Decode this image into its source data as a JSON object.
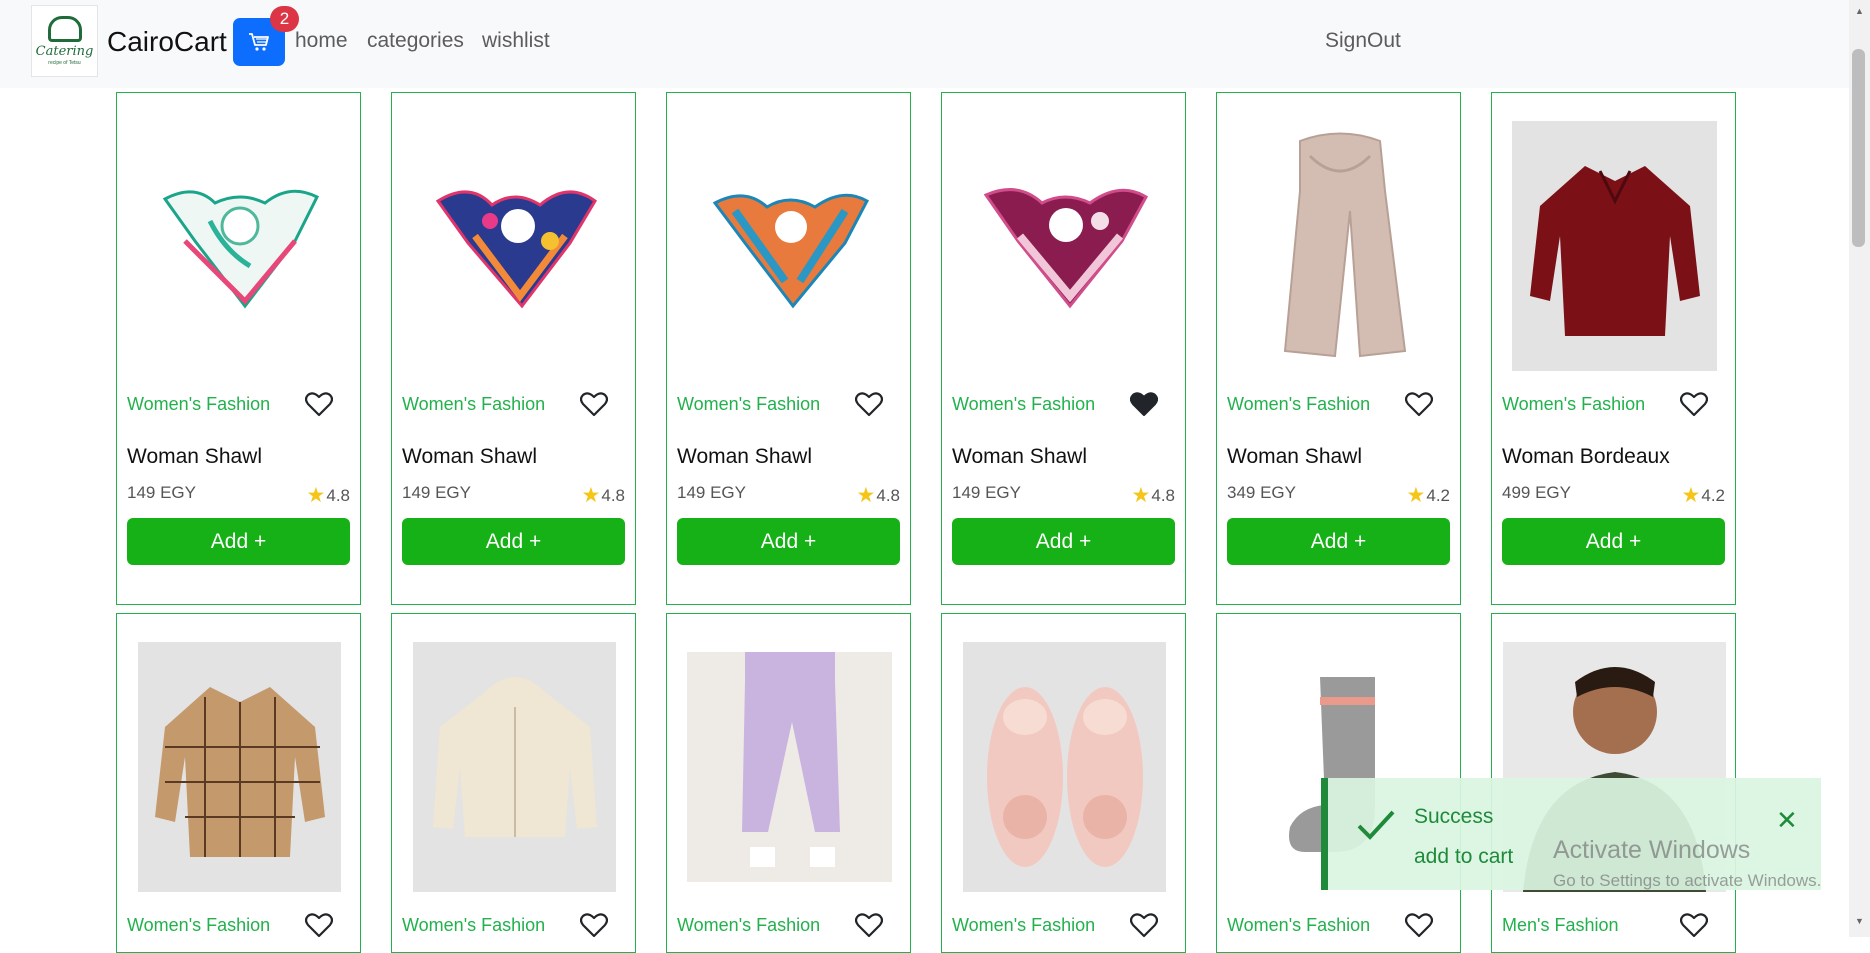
{
  "nav": {
    "logo_text": "Catering",
    "logo_sub": "recipe of Tetsu",
    "brand": "CairoCart",
    "cart_count": "2",
    "links": {
      "home": "home",
      "categories": "categories",
      "wishlist": "wishlist",
      "signout": "SignOut"
    }
  },
  "products": [
    {
      "category": "Women's Fashion",
      "title": "Woman Shawl",
      "price": "149 EGY",
      "rating": "4.8",
      "add": "Add +",
      "wishlisted": false
    },
    {
      "category": "Women's Fashion",
      "title": "Woman Shawl",
      "price": "149 EGY",
      "rating": "4.8",
      "add": "Add +",
      "wishlisted": false
    },
    {
      "category": "Women's Fashion",
      "title": "Woman Shawl",
      "price": "149 EGY",
      "rating": "4.8",
      "add": "Add +",
      "wishlisted": false
    },
    {
      "category": "Women's Fashion",
      "title": "Woman Shawl",
      "price": "149 EGY",
      "rating": "4.8",
      "add": "Add +",
      "wishlisted": true
    },
    {
      "category": "Women's Fashion",
      "title": "Woman Shawl",
      "price": "349 EGY",
      "rating": "4.2",
      "add": "Add +",
      "wishlisted": false
    },
    {
      "category": "Women's Fashion",
      "title": "Woman Bordeaux",
      "price": "499 EGY",
      "rating": "4.2",
      "add": "Add +",
      "wishlisted": false
    },
    {
      "category": "Women's Fashion",
      "wishlisted": false
    },
    {
      "category": "Women's Fashion",
      "wishlisted": false
    },
    {
      "category": "Women's Fashion",
      "wishlisted": false
    },
    {
      "category": "Women's Fashion",
      "wishlisted": false
    },
    {
      "category": "Women's Fashion",
      "wishlisted": false
    },
    {
      "category": "Men's Fashion",
      "wishlisted": false
    }
  ],
  "toast": {
    "title": "Success",
    "message": "add to cart"
  },
  "watermark": {
    "title": "Activate Windows",
    "subtitle": "Go to Settings to activate Windows."
  },
  "colors": {
    "accent_green": "#16b116",
    "category_green": "#22b14c",
    "cart_blue": "#0d6efd",
    "badge_red": "#dc3545"
  }
}
